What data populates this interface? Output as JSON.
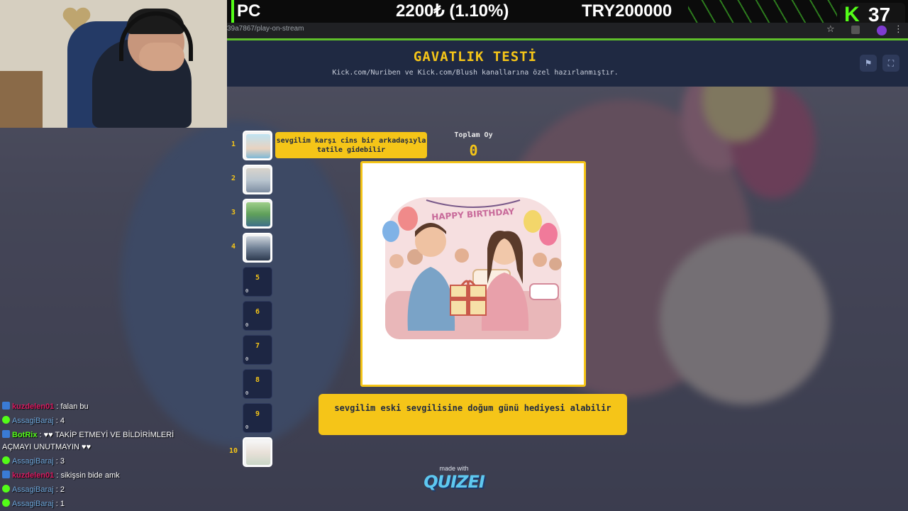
{
  "stream_overlay": {
    "platform": "PC",
    "donation": "2200₺ (1.10%)",
    "goal": "TRY200000",
    "viewer_count": "37",
    "kick_logo": "K"
  },
  "browser": {
    "url": "39a7867/play-on-stream",
    "star_icon": "☆",
    "menu_icon": "⋮"
  },
  "site": {
    "title": "GAVATLIK TESTİ",
    "subtitle": "Kick.com/Nuriben ve Kick.com/Blush kanallarına özel hazırlanmıştır.",
    "flag_icon": "⚑",
    "fullscreen_icon": "⛶"
  },
  "quiz": {
    "total_votes_label": "Toplam Oy",
    "total_votes_value": "0",
    "tooltip_text": "sevgilim karşı cins bir arkadaşıyla tatile gidebilir",
    "current_answer": "sevgilim eski sevgilisine doğum günü hediyesi alabilir",
    "card_banner": "HAPPY BIRTHDAY",
    "thumbnails": [
      {
        "num": "1",
        "has_image": true,
        "votes": ""
      },
      {
        "num": "2",
        "has_image": true,
        "votes": ""
      },
      {
        "num": "3",
        "has_image": true,
        "votes": ""
      },
      {
        "num": "4",
        "has_image": true,
        "votes": ""
      },
      {
        "num": "5",
        "has_image": false,
        "votes": "0"
      },
      {
        "num": "6",
        "has_image": false,
        "votes": "0"
      },
      {
        "num": "7",
        "has_image": false,
        "votes": "0"
      },
      {
        "num": "8",
        "has_image": false,
        "votes": "0"
      },
      {
        "num": "9",
        "has_image": false,
        "votes": "0"
      },
      {
        "num": "10",
        "has_image": true,
        "votes": ""
      }
    ]
  },
  "footer": {
    "made_with": "made with",
    "brand": "QUIZEI"
  },
  "chat": {
    "messages": [
      {
        "user": "kuzdelen01",
        "text": ": falan bu",
        "style": "red",
        "badge": "blue"
      },
      {
        "user": "AssagiBaraj",
        "text": ": 4",
        "style": "blue",
        "badge": "green"
      },
      {
        "user": "BotRix",
        "text": ": ♥♥ TAKİP ETMEYİ VE BİLDİRİMLERİ",
        "style": "green",
        "badge": "blue"
      },
      {
        "user": "",
        "text": "AÇMAYI UNUTMAYIN ♥♥",
        "style": "plain",
        "badge": ""
      },
      {
        "user": "AssagiBaraj",
        "text": ": 3",
        "style": "blue",
        "badge": "green"
      },
      {
        "user": "kuzdelen01",
        "text": ": sikişsin bide amk",
        "style": "red",
        "badge": "blue"
      },
      {
        "user": "AssagiBaraj",
        "text": ": 2",
        "style": "blue",
        "badge": "green"
      },
      {
        "user": "AssagiBaraj",
        "text": ": 1",
        "style": "blue",
        "badge": "green"
      }
    ]
  },
  "colors": {
    "accent_yellow": "#f5c518",
    "header_navy": "#1f2942",
    "kick_green": "#53fc18"
  }
}
